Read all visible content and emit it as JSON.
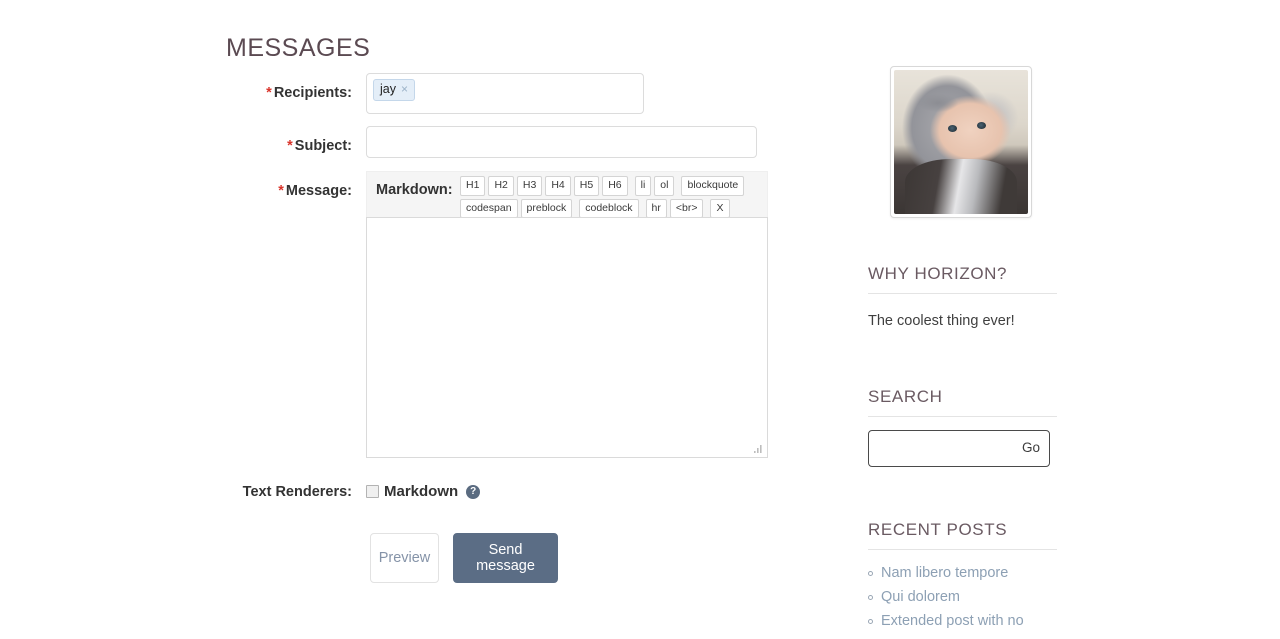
{
  "main": {
    "page_title": "MESSAGES",
    "fields": {
      "recipients": {
        "label": "Recipients:",
        "required_marker": "*",
        "tokens": [
          {
            "text": "jay",
            "remove": "×"
          }
        ]
      },
      "subject": {
        "label": "Subject:",
        "required_marker": "*",
        "value": "",
        "placeholder": ""
      },
      "message": {
        "label": "Message:",
        "required_marker": "*",
        "value": "",
        "placeholder": ""
      }
    },
    "markdown_toolbar": {
      "label": "Markdown:",
      "row1": [
        "H1",
        "H2",
        "H3",
        "H4",
        "H5",
        "H6",
        "li",
        "ol",
        "blockquote"
      ],
      "row2": [
        "codespan",
        "preblock",
        "codeblock",
        "hr",
        "<br>",
        "X"
      ]
    },
    "text_renderers": {
      "label": "Text Renderers:",
      "checkbox_label": "Markdown",
      "checked": false,
      "help_glyph": "?"
    },
    "buttons": {
      "preview": "Preview",
      "send": "Send message"
    }
  },
  "sidebar": {
    "avatar_alt": "baby wearing grey knit hood",
    "why": {
      "heading": "WHY HORIZON?",
      "body": "The coolest thing ever!"
    },
    "search": {
      "heading": "SEARCH",
      "value": "",
      "placeholder": "",
      "go_label": "Go"
    },
    "recent_posts": {
      "heading": "RECENT POSTS",
      "items": [
        "Nam libero tempore",
        "Qui dolorem",
        "Extended post with no"
      ]
    }
  },
  "colors": {
    "heading": "#6a5a62",
    "required": "#d9342b",
    "primary_button": "#5b6d85",
    "secondary_text": "#8da0b4",
    "token_bg": "#e4eef8"
  }
}
